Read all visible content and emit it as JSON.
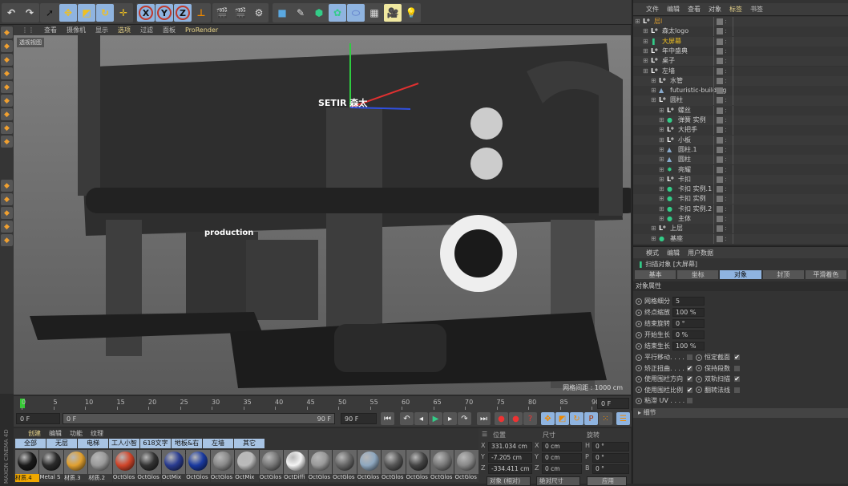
{
  "toolbar": {
    "groups": [
      {
        "name": "undo",
        "items": [
          "undo-icon",
          "redo-icon"
        ]
      },
      {
        "name": "tools",
        "items": [
          "select-icon",
          "move-icon",
          "scale-icon",
          "rotate-icon",
          "move-last-icon"
        ]
      },
      {
        "name": "axes",
        "items": [
          "X",
          "Y",
          "Z",
          "coordinate-system-icon"
        ]
      },
      {
        "name": "render",
        "items": [
          "render-view-icon",
          "render-picture-queue-icon",
          "render-settings-icon"
        ]
      },
      {
        "name": "create",
        "items": [
          "cube-icon",
          "pen-icon",
          "subdivision-icon",
          "array-icon",
          "deformer-icon",
          "floor-icon",
          "camera-icon",
          "light-icon"
        ]
      }
    ]
  },
  "viewport": {
    "menu": [
      "查看",
      "摄像机",
      "显示",
      "选项",
      "过滤",
      "面板",
      "ProRender"
    ],
    "highlighted_menu": "选项",
    "label": "透视视图",
    "grid_spacing": "网格间距 : 1000 cm",
    "scene_texts": {
      "logo": "SETIR 森太",
      "sign": "production"
    }
  },
  "timeline": {
    "ticks": [
      "0",
      "5",
      "10",
      "15",
      "20",
      "25",
      "30",
      "35",
      "40",
      "45",
      "50",
      "55",
      "60",
      "65",
      "70",
      "75",
      "80",
      "85",
      "90"
    ],
    "current_frame": "0 F",
    "start": "0 F",
    "slider_start": "0 F",
    "slider_end": "90 F",
    "end": "90 F"
  },
  "materials": {
    "menu": [
      "创建",
      "编辑",
      "功能",
      "纹理"
    ],
    "filters": [
      "全部",
      "无层",
      "电梯",
      "工人小智",
      "618文字",
      "地板&右墙",
      "左墙",
      "其它"
    ],
    "items": [
      {
        "name": "材质.4",
        "color": "#1a1a1a",
        "selected": true
      },
      {
        "name": "Metal S",
        "color": "#2a2a2a"
      },
      {
        "name": "材质.3",
        "color": "#e0a030"
      },
      {
        "name": "材质.2",
        "color": "#9a9a9a"
      },
      {
        "name": "OctGlos",
        "color": "#d0452a"
      },
      {
        "name": "OctGlos",
        "color": "#333"
      },
      {
        "name": "OctMix",
        "color": "#2a3c90"
      },
      {
        "name": "OctGlos",
        "color": "#1a3aa0"
      },
      {
        "name": "OctGlos",
        "color": "#888"
      },
      {
        "name": "OctMix",
        "color": "#bbb"
      },
      {
        "name": "OctGlos",
        "color": "#777"
      },
      {
        "name": "OctDiffi",
        "color": "#f4f4f4"
      },
      {
        "name": "OctGlos",
        "color": "#999"
      },
      {
        "name": "OctGlos",
        "color": "#666"
      },
      {
        "name": "OctGlos",
        "color": "#8fa8c0"
      },
      {
        "name": "OctGlos",
        "color": "#555"
      },
      {
        "name": "OctGlos",
        "color": "#444"
      },
      {
        "name": "OctGlos",
        "color": "#777"
      },
      {
        "name": "OctGlos",
        "color": "#888"
      }
    ]
  },
  "coords": {
    "headers": [
      "位置",
      "尺寸",
      "旋转"
    ],
    "rows": [
      {
        "axis": "X",
        "pos": "331.034 cm",
        "size_axis": "X",
        "size": "0 cm",
        "rot_axis": "H",
        "rot": "0 °"
      },
      {
        "axis": "Y",
        "pos": "-7.205 cm",
        "size_axis": "Y",
        "size": "0 cm",
        "rot_axis": "P",
        "rot": "0 °"
      },
      {
        "axis": "Z",
        "pos": "-334.411 cm",
        "size_axis": "Z",
        "size": "0 cm",
        "rot_axis": "B",
        "rot": "0 °"
      }
    ],
    "mode": "对象 (相对)",
    "size_mode": "绝对尺寸",
    "apply": "应用"
  },
  "object_manager": {
    "menu": [
      "文件",
      "编辑",
      "查看",
      "对象",
      "标签",
      "书签"
    ],
    "highlighted_menu": "标签",
    "objects": [
      {
        "name": "层l",
        "level": 0,
        "icon": "null",
        "color": "#e0a030"
      },
      {
        "name": "森太logo",
        "level": 1,
        "icon": "null"
      },
      {
        "name": "大屏幕",
        "level": 1,
        "icon": "sweep",
        "color": "#f0c020"
      },
      {
        "name": "年中盛典",
        "level": 1,
        "icon": "null"
      },
      {
        "name": "桌子",
        "level": 1,
        "icon": "null"
      },
      {
        "name": "左墙",
        "level": 1,
        "icon": "null"
      },
      {
        "name": "水管",
        "level": 2,
        "icon": "null"
      },
      {
        "name": "futuristic-building",
        "level": 2,
        "icon": "poly"
      },
      {
        "name": "圆柱",
        "level": 2,
        "icon": "null"
      },
      {
        "name": "螺丝",
        "level": 3,
        "icon": "null"
      },
      {
        "name": "弹簧 实例",
        "level": 3,
        "icon": "instance"
      },
      {
        "name": "大把手",
        "level": 3,
        "icon": "null"
      },
      {
        "name": "小板",
        "level": 3,
        "icon": "null"
      },
      {
        "name": "圆柱.1",
        "level": 3,
        "icon": "poly"
      },
      {
        "name": "圆柱",
        "level": 3,
        "icon": "poly"
      },
      {
        "name": "亮耀",
        "level": 3,
        "icon": "cloner"
      },
      {
        "name": "卡扣",
        "level": 3,
        "icon": "null"
      },
      {
        "name": "卡扣 实例.1",
        "level": 3,
        "icon": "instance"
      },
      {
        "name": "卡扣 实例",
        "level": 3,
        "icon": "instance"
      },
      {
        "name": "卡扣 实例.2",
        "level": 3,
        "icon": "instance"
      },
      {
        "name": "主体",
        "level": 3,
        "icon": "instance"
      },
      {
        "name": "上层",
        "level": 2,
        "icon": "null"
      },
      {
        "name": "基座",
        "level": 2,
        "icon": "instance"
      }
    ]
  },
  "attributes": {
    "menu": [
      "模式",
      "编辑",
      "用户数据"
    ],
    "title": "扫描对象 [大屏幕]",
    "tabs": [
      "基本",
      "坐标",
      "对象",
      "封顶",
      "平滑着色"
    ],
    "active_tab": "对象",
    "section": "对象属性",
    "fields": [
      {
        "label": "网格细分",
        "value": "5"
      },
      {
        "label": "终点缩放",
        "value": "100 %"
      },
      {
        "label": "结束旋转",
        "value": "0 °"
      },
      {
        "label": "开始生长",
        "value": "0 %"
      },
      {
        "label": "结束生长",
        "value": "100 %"
      }
    ],
    "checks_left": [
      {
        "label": "平行移动. . . .",
        "checked": false
      },
      {
        "label": "矫正扭曲. . . .",
        "checked": true
      },
      {
        "label": "使用围栏方向",
        "checked": true
      },
      {
        "label": "使用围栏比例",
        "checked": true
      },
      {
        "label": "粘滞 UV . . . .",
        "checked": false
      }
    ],
    "checks_right": [
      {
        "label": "恒定截面",
        "checked": true
      },
      {
        "label": "保持段数",
        "checked": false
      },
      {
        "label": "双轨扫描",
        "checked": true
      },
      {
        "label": "翻转法线",
        "checked": false
      }
    ],
    "details": "细节"
  },
  "brand": "MAXON CINEMA 4D"
}
